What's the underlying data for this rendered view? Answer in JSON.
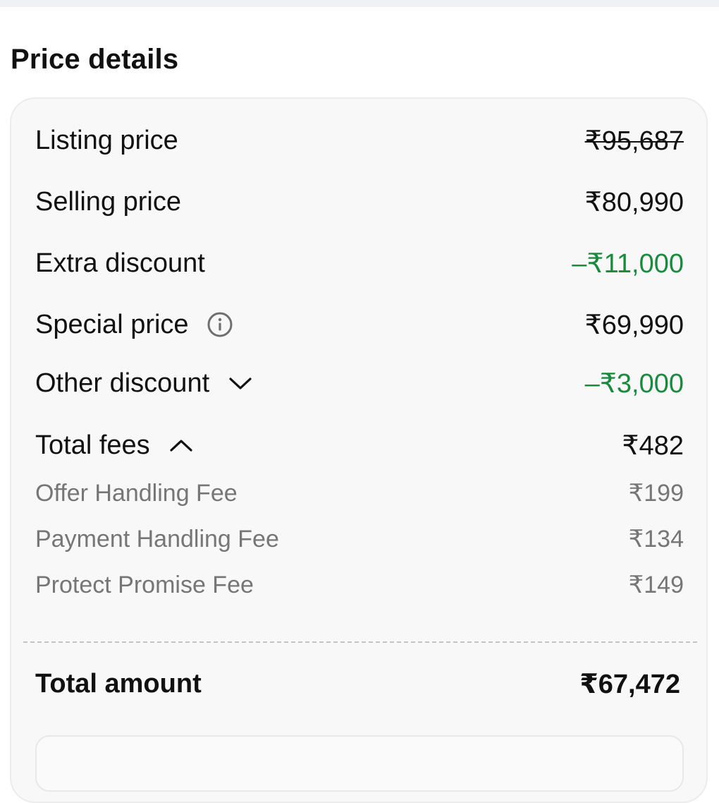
{
  "header": {
    "title": "Price details"
  },
  "rows": {
    "listing": {
      "label": "Listing price",
      "value": "₹95,687"
    },
    "selling": {
      "label": "Selling price",
      "value": "₹80,990"
    },
    "extra_discount": {
      "label": "Extra discount",
      "value": "–₹11,000"
    },
    "special": {
      "label": "Special price",
      "value": "₹69,990"
    },
    "other_discount": {
      "label": "Other discount",
      "value": "–₹3,000"
    },
    "total_fees": {
      "label": "Total fees",
      "value": "₹482"
    }
  },
  "fees": [
    {
      "label": "Offer Handling Fee",
      "value": "₹199"
    },
    {
      "label": "Payment Handling Fee",
      "value": "₹134"
    },
    {
      "label": "Protect Promise Fee",
      "value": "₹149"
    }
  ],
  "total": {
    "label": "Total amount",
    "value": "₹67,472"
  },
  "icons": {
    "special_price": "info-icon",
    "other_discount": "chevron-down-icon",
    "total_fees": "chevron-up-icon"
  },
  "colors": {
    "discount": "#1a8a3f",
    "muted_text": "#767676",
    "card_background": "#f8f8f8"
  }
}
